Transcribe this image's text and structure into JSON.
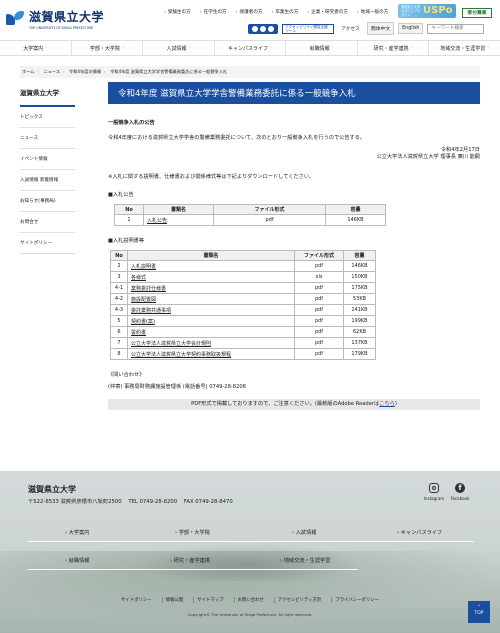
{
  "header": {
    "logo_jp": "滋賀県立大学",
    "logo_en": "THE UNIVERSITY OF SHIGA PREFECTURE",
    "toplinks": [
      "受験生の方",
      "在学生の方",
      "保護者の方",
      "卒業生の方",
      "企業・研究者の方",
      "地域一般の方"
    ],
    "accessibility_label": "アクセシビリティ閲覧支援ツール",
    "access_label": "アクセス",
    "lang_zh": "簡体中文",
    "lang_en": "English",
    "search_placeholder": "キーワード検索",
    "uspo_small": "滋賀県立大学公式ウェブマガジン",
    "uspo_big": "USPo",
    "donate_label": "寄付募集"
  },
  "nav": [
    "大学案内",
    "学部・大学院",
    "入試情報",
    "キャンパスライフ",
    "就職情報",
    "研究・産学連携",
    "地域交流・生涯学習"
  ],
  "breadcrumb": [
    "ホーム",
    "ニュース",
    "令和4年度の情報",
    "令和4年度 滋賀県立大学学舎警備業務委託に係る一般競争入札"
  ],
  "sidebar": {
    "title": "滋賀県立大学",
    "items": [
      "トピックス",
      "ニュース",
      "イベント情報",
      "入試情報 新着情報",
      "お知らせ(事務局)",
      "お問合せ",
      "サイトポリシー"
    ]
  },
  "main": {
    "title": "令和4年度 滋賀県立大学学舎警備業務委託に係る一般競争入札",
    "notice_heading": "一般競争入札の公告",
    "intro": "令和4年度における滋賀県立大学学舎の警備業務委託について、次のとおり一般競争入札を行うので公告する。",
    "date": "令和4年2月17日",
    "signer": "公立大学法人滋賀県立大学 理事長 廣川 能嗣",
    "note": "※入札に関する説明書、仕様書および関係様式等は下記よりダウンロードしてください。",
    "section1": "■入札公告",
    "table1_headers": [
      "No",
      "書類名",
      "ファイル形式",
      "容量"
    ],
    "table1_rows": [
      [
        "1",
        "入札公告",
        "pdf",
        "146KB"
      ]
    ],
    "section2": "■入札説明書等",
    "table2_headers": [
      "No",
      "書類名",
      "ファイル形式",
      "容量"
    ],
    "table2_rows": [
      [
        "2",
        "入札説明書",
        "pdf",
        "146KB"
      ],
      [
        "3",
        "各様式",
        "xls",
        "150KB"
      ],
      [
        "4-1",
        "業務委託仕様書",
        "pdf",
        "175KB"
      ],
      [
        "4-2",
        "施設配置図",
        "pdf",
        "53KB"
      ],
      [
        "4-3",
        "委託業務共通事項",
        "pdf",
        "141KB"
      ],
      [
        "5",
        "契約書(案)",
        "pdf",
        "199KB"
      ],
      [
        "6",
        "誓約書",
        "pdf",
        "62KB"
      ],
      [
        "7",
        "公立大学法人滋賀県立大学会計規則",
        "pdf",
        "137KB"
      ],
      [
        "8",
        "公立大学法人滋賀県立大学契約事務取扱規程",
        "pdf",
        "179KB"
      ]
    ],
    "inquiry_label": "《問い合わせ》",
    "inquiry_text": "(仲寄) 事務局財務課施設管理係 (電話番号) 0749-28-8208",
    "pdf_note": "PDF形式で掲載しておりますので、ご注意ください。(最新版のAdobe Readerは",
    "pdf_link": "こちら",
    "pdf_tail": ")"
  },
  "footer": {
    "name": "滋賀県立大学",
    "postal": "〒522-8533 滋賀県彦根市八坂町2500",
    "tel": "TEL 0749-28-8200",
    "fax": "FAX 0749-28-8470",
    "instagram": "Instagram",
    "facebook": "Facebook",
    "fb_glyph": "f",
    "nav": [
      "大学案内",
      "学部・大学院",
      "入試情報",
      "キャンパスライフ",
      "就職情報",
      "研究・産学連携",
      "地域交流・生涯学習"
    ],
    "links": [
      "サイトポリシー",
      "情報公開",
      "サイトマップ",
      "お問い合わせ",
      "アクセシビリティ方針",
      "プライバシーポリシー"
    ],
    "copyright": "Copyright© The University of Shiga Prefecture. All right reserved.",
    "top_label": "TOP",
    "top_arrow": "⌃"
  }
}
